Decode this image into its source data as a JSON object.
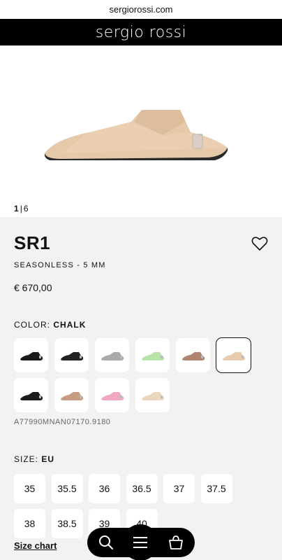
{
  "browser": {
    "url": "sergiorossi.com"
  },
  "header": {
    "brand": "sergio rossi"
  },
  "gallery": {
    "current": "1",
    "separator": "|",
    "total": "6"
  },
  "product": {
    "name": "SR1",
    "subtitle": "SEASONLESS - 5 MM",
    "price": "€ 670,00",
    "color_label": "COLOR:",
    "color_value": "CHALK",
    "sku": "A77990MNAN07170.9180"
  },
  "swatches": [
    {
      "name": "black",
      "color": "#1a1a1a"
    },
    {
      "name": "black-white",
      "color": "#222222"
    },
    {
      "name": "grey",
      "color": "#a9aba8"
    },
    {
      "name": "mint",
      "color": "#b8e3a8"
    },
    {
      "name": "brown",
      "color": "#b08470"
    },
    {
      "name": "chalk",
      "color": "#e7ccb0",
      "selected": true
    },
    {
      "name": "black-2",
      "color": "#1c1c1c"
    },
    {
      "name": "nude",
      "color": "#c69b82"
    },
    {
      "name": "pink",
      "color": "#f0a7c0"
    },
    {
      "name": "cream",
      "color": "#ead7bd"
    }
  ],
  "sizes": {
    "label": "SIZE:",
    "system": "EU",
    "options": [
      "35",
      "35.5",
      "36",
      "36.5",
      "37",
      "37.5",
      "38",
      "38.5",
      "39",
      "40"
    ],
    "chart_link": "Size chart"
  },
  "icons": {
    "wishlist": "heart-icon",
    "search": "search-icon",
    "menu": "menu-icon",
    "bag": "bag-icon"
  }
}
